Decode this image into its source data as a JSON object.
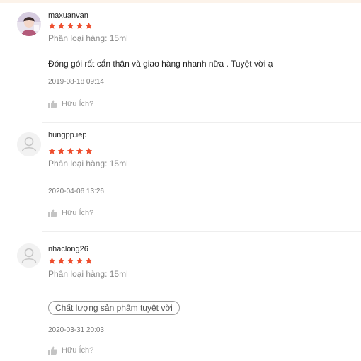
{
  "reviews": [
    {
      "username": "maxuanvan",
      "rating": 5,
      "avatar": "user-photo",
      "variant": "Phân loại hàng: 15ml",
      "comment": "Đóng gói rất cẩn thận và giao hàng nhanh nữa . Tuyệt vời ạ",
      "timestamp": "2019-08-18 09:14",
      "helpful_label": "Hữu Ích?"
    },
    {
      "username": "hungpp.iep",
      "rating": 5,
      "avatar": "default-user-icon",
      "variant": "Phân loại hàng: 15ml",
      "timestamp": "2020-04-06 13:26",
      "helpful_label": "Hữu Ích?"
    },
    {
      "username": "nhaclong26",
      "rating": 5,
      "avatar": "default-user-icon",
      "variant": "Phân loại hàng: 15ml",
      "tag": "Chất lượng sản phẩm tuyệt vời",
      "timestamp": "2020-03-31 20:03",
      "helpful_label": "Hữu Ích?"
    }
  ],
  "colors": {
    "star": "#ee4d2d",
    "muted_text": "#888888",
    "divider": "#eeeeee"
  },
  "icons": {
    "star": "star-icon",
    "like": "thumbs-up-icon",
    "default_avatar": "user-icon"
  }
}
